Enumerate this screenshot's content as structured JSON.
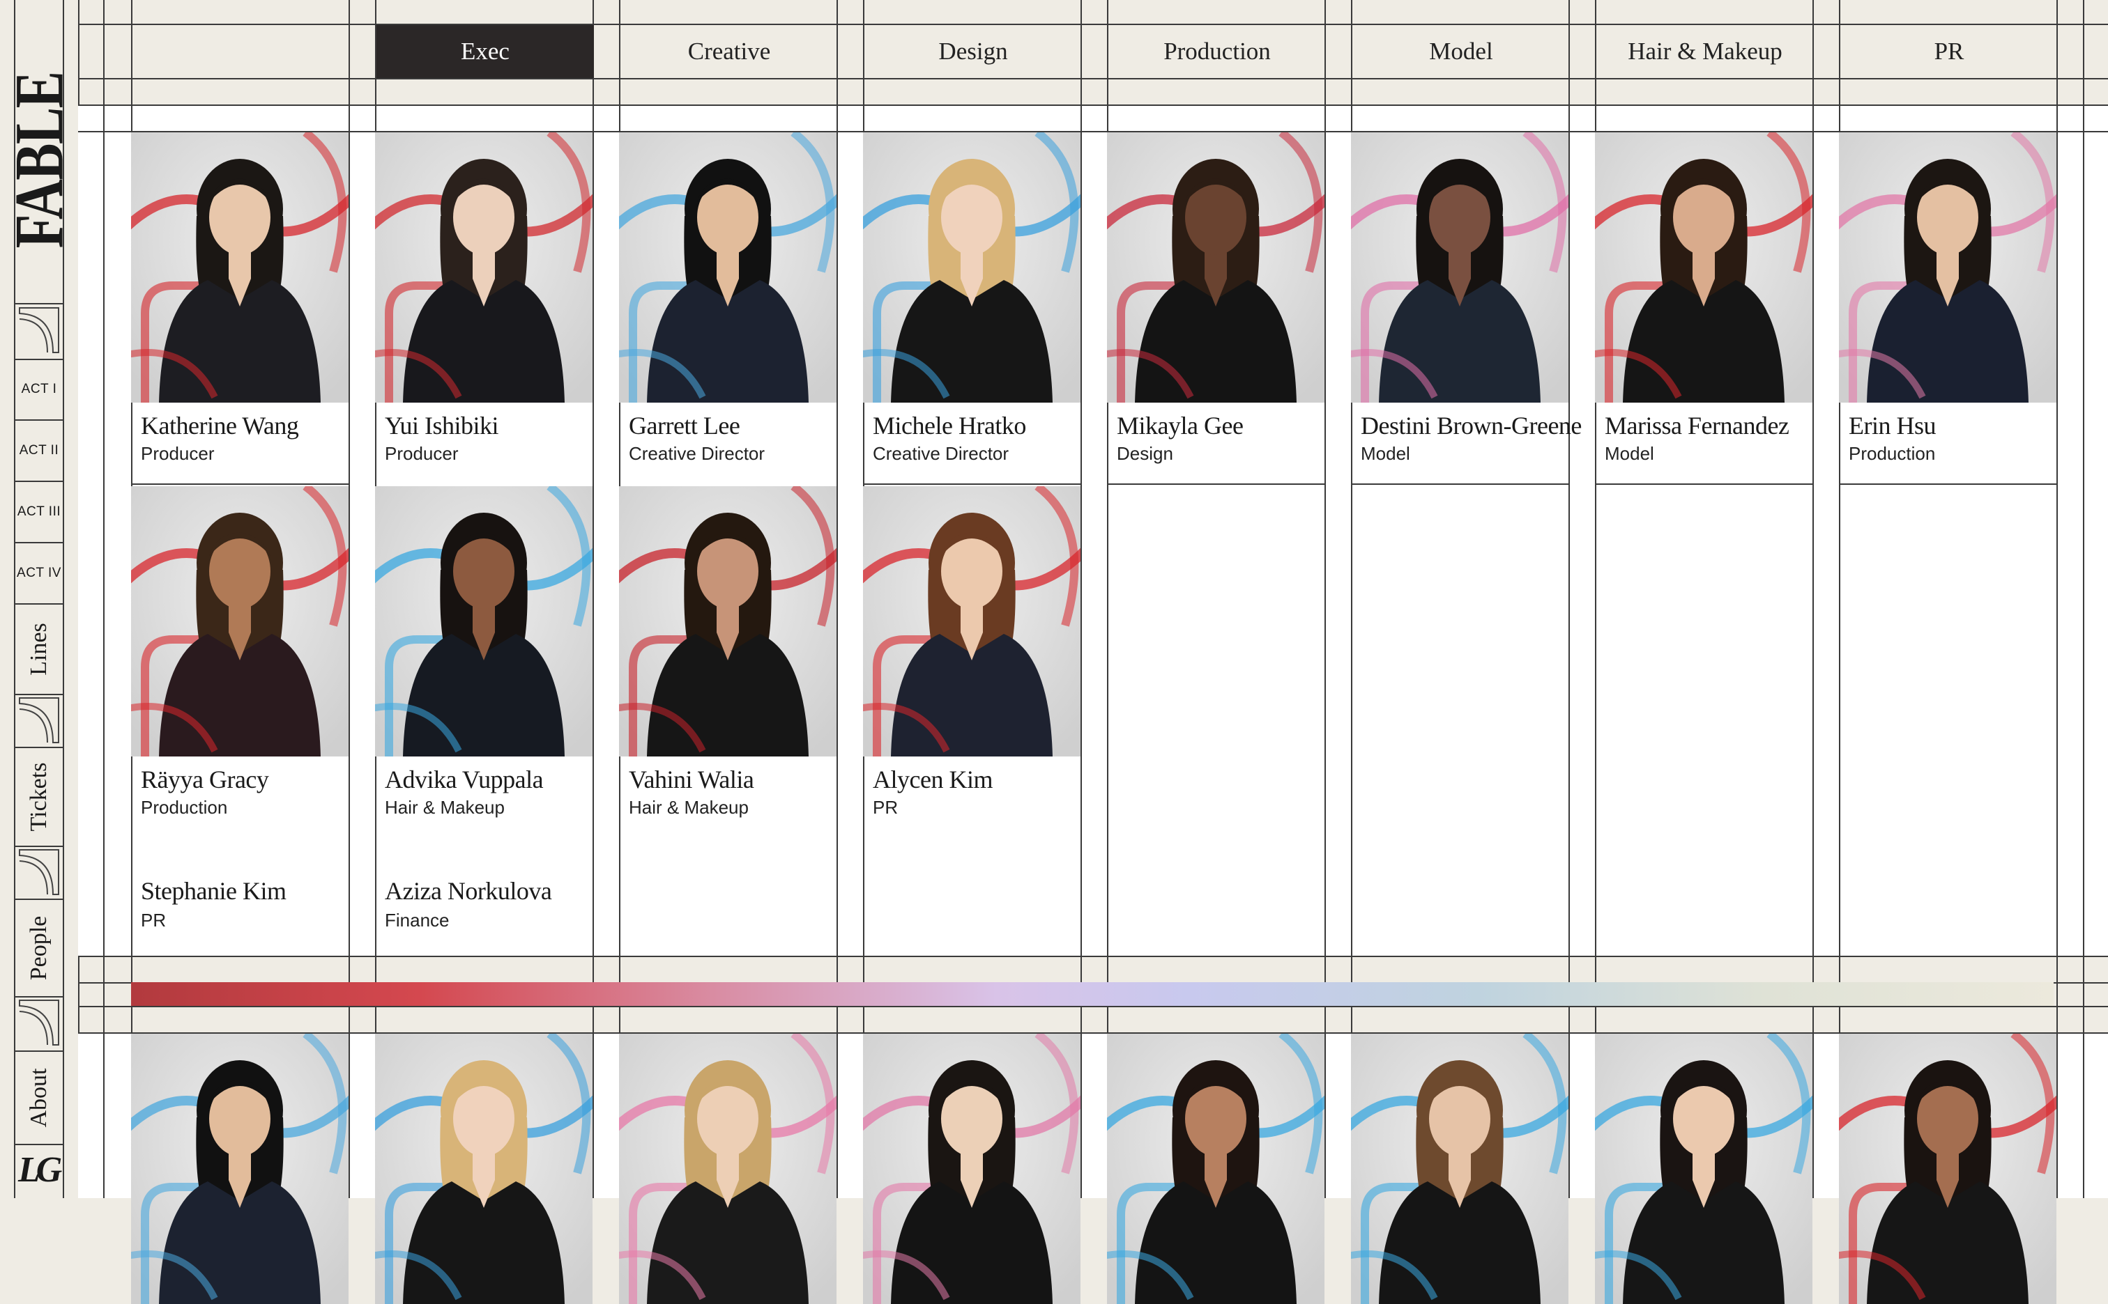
{
  "brand": {
    "wordmark": "FABLE",
    "logo_text": "LG"
  },
  "sidebar": {
    "acts": [
      "ACT I",
      "ACT II",
      "ACT III",
      "ACT IV"
    ],
    "links": [
      "Lines",
      "Tickets",
      "People",
      "About"
    ]
  },
  "tabs": [
    {
      "label": "Exec",
      "active": true
    },
    {
      "label": "Creative",
      "active": false
    },
    {
      "label": "Design",
      "active": false
    },
    {
      "label": "Production",
      "active": false
    },
    {
      "label": "Model",
      "active": false
    },
    {
      "label": "Hair & Makeup",
      "active": false
    },
    {
      "label": "PR",
      "active": false
    }
  ],
  "people_row1": [
    {
      "name": "Katherine Wang",
      "role": "Producer",
      "skin": "#e8c7ab",
      "hair": "#1b1714",
      "outfit": "#1d1d22",
      "accent": "#d6262c"
    },
    {
      "name": "Yui Ishibiki",
      "role": "Producer",
      "skin": "#ecd0bb",
      "hair": "#2b211c",
      "outfit": "#18181c",
      "accent": "#d22a2f"
    },
    {
      "name": "Garrett Lee",
      "role": "Creative Director",
      "skin": "#e2bc9b",
      "hair": "#111111",
      "outfit": "#1c2230",
      "accent": "#4aa8de"
    },
    {
      "name": "Michele Hratko",
      "role": "Creative Director",
      "skin": "#f0d2bc",
      "hair": "#d8b478",
      "outfit": "#161616",
      "accent": "#3aa0dd"
    },
    {
      "name": "Mikayla Gee",
      "role": "Design",
      "skin": "#6a4330",
      "hair": "#2c1d14",
      "outfit": "#141414",
      "accent": "#c92a3c"
    },
    {
      "name": "Destini Brown-Greene",
      "role": "Model",
      "skin": "#7a5040",
      "hair": "#161210",
      "outfit": "#1e2633",
      "accent": "#e070a8"
    },
    {
      "name": "Marissa Fernandez",
      "role": "Model",
      "skin": "#d9ab8c",
      "hair": "#2a1b12",
      "outfit": "#151515",
      "accent": "#d8262c"
    },
    {
      "name": "Erin Hsu",
      "role": "Production",
      "skin": "#e4c0a2",
      "hair": "#1c1612",
      "outfit": "#1a2030",
      "accent": "#e27aa8"
    }
  ],
  "people_row2": [
    {
      "name": "Räyya Gracy",
      "role": "Production",
      "skin": "#b07a56",
      "hair": "#3b2718",
      "outfit": "#2a1a1e",
      "accent": "#d8262c"
    },
    {
      "name": "Advika Vuppala",
      "role": "Hair & Makeup",
      "skin": "#8d5a3f",
      "hair": "#171210",
      "outfit": "#161a22",
      "accent": "#3aa8e0"
    },
    {
      "name": "Vahini Walia",
      "role": "Hair & Makeup",
      "skin": "#c79478",
      "hair": "#24180f",
      "outfit": "#161616",
      "accent": "#c8232b"
    },
    {
      "name": "Alycen Kim",
      "role": "PR",
      "skin": "#ecc9ad",
      "hair": "#6a3b22",
      "outfit": "#1e2230",
      "accent": "#d8262c"
    }
  ],
  "extra_people": [
    {
      "name": "Stephanie Kim",
      "role": "PR"
    },
    {
      "name": "Aziza Norkulova",
      "role": "Finance"
    }
  ],
  "people_row3": [
    {
      "skin": "#e2bc9b",
      "hair": "#111111",
      "outfit": "#1c2230",
      "accent": "#4aa8de"
    },
    {
      "skin": "#f0d2bc",
      "hair": "#d8b478",
      "outfit": "#161616",
      "accent": "#3aa0dd"
    },
    {
      "skin": "#edcfb5",
      "hair": "#c9a56a",
      "outfit": "#1a1a1a",
      "accent": "#e77aa8"
    },
    {
      "skin": "#ecd0b7",
      "hair": "#1a1512",
      "outfit": "#141414",
      "accent": "#e27aa8"
    },
    {
      "skin": "#b78060",
      "hair": "#1e1410",
      "outfit": "#141414",
      "accent": "#3aa8e0"
    },
    {
      "skin": "#e6c3a7",
      "hair": "#6e4a2e",
      "outfit": "#151515",
      "accent": "#3aa8e0"
    },
    {
      "skin": "#ebc9ae",
      "hair": "#1a1412",
      "outfit": "#161616",
      "accent": "#3aa8e0"
    },
    {
      "skin": "#a46e50",
      "hair": "#1a1310",
      "outfit": "#161616",
      "accent": "#d8262c"
    }
  ]
}
